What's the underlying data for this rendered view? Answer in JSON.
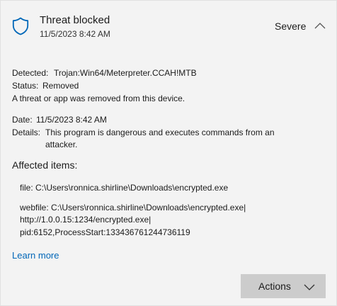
{
  "header": {
    "title": "Threat blocked",
    "timestamp": "11/5/2023 8:42 AM",
    "severity": "Severe",
    "shield_icon": "shield-icon",
    "collapse_icon": "chevron-up-icon",
    "accent_color": "#0067b8"
  },
  "details": {
    "detected_label": "Detected:",
    "detected_value": "Trojan:Win64/Meterpreter.CCAH!MTB",
    "status_label": "Status:",
    "status_value": "Removed",
    "status_message": "A threat or app was removed from this device.",
    "date_label": "Date:",
    "date_value": "11/5/2023 8:42 AM",
    "details_label": "Details:",
    "details_line1": "This program is dangerous and executes commands from an",
    "details_line2": "attacker."
  },
  "affected": {
    "heading": "Affected items:",
    "file_line": "file: C:\\Users\\ronnica.shirline\\Downloads\\encrypted.exe",
    "webfile_line1": "webfile: C:\\Users\\ronnica.shirline\\Downloads\\encrypted.exe|",
    "webfile_line2": "http://1.0.0.15:1234/encrypted.exe|",
    "webfile_line3": "pid:6152,ProcessStart:133436761244736119"
  },
  "footer": {
    "learn_more": "Learn more",
    "actions_label": "Actions",
    "actions_icon": "chevron-down-icon"
  }
}
